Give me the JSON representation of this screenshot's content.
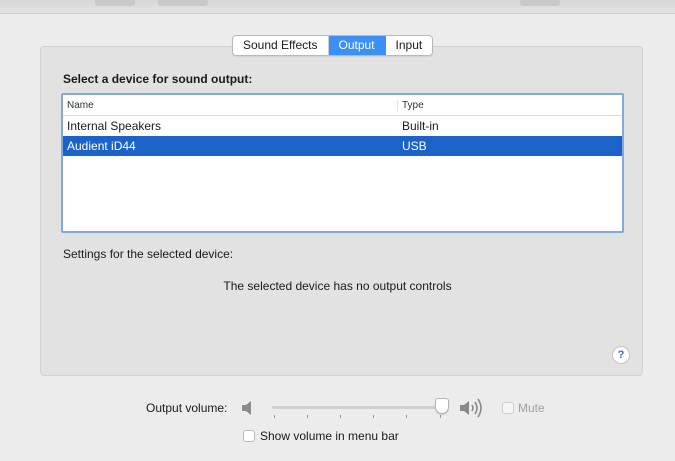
{
  "tabs": [
    {
      "label": "Sound Effects",
      "active": false
    },
    {
      "label": "Output",
      "active": true
    },
    {
      "label": "Input",
      "active": false
    }
  ],
  "output": {
    "section_title": "Select a device for sound output:",
    "columns": {
      "name": "Name",
      "type": "Type"
    },
    "devices": [
      {
        "name": "Internal Speakers",
        "type": "Built-in",
        "selected": false
      },
      {
        "name": "Audient iD44",
        "type": "USB",
        "selected": true
      }
    ],
    "settings_label": "Settings for the selected device:",
    "no_controls_message": "The selected device has no output controls",
    "help_label": "?"
  },
  "volume": {
    "label": "Output volume:",
    "level": 0.95,
    "mute_label": "Mute",
    "mute_checked": false,
    "mute_enabled": false
  },
  "menu_bar": {
    "label": "Show volume in menu bar",
    "checked": false
  },
  "colors": {
    "accent": "#3b8ff5",
    "selection": "#1b63c9",
    "table_focus_border": "#7fa9e3"
  },
  "icons": [
    "speaker-low-icon",
    "speaker-high-icon",
    "help-icon"
  ]
}
